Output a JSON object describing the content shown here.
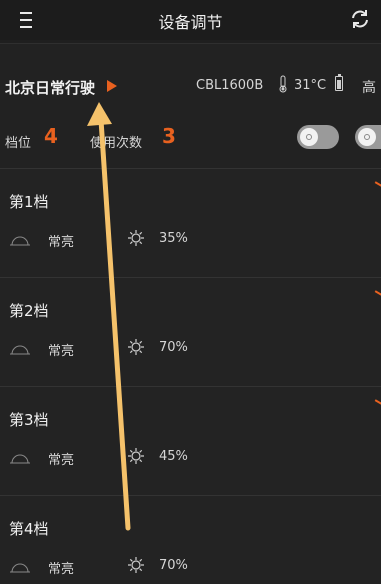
{
  "header": {
    "title": "设备调节"
  },
  "device": {
    "mode_name": "北京日常行驶",
    "model": "CBL1600B",
    "temperature": "31°C",
    "level_tag": "高"
  },
  "stats": {
    "gear_label": "档位",
    "gear_count": "4",
    "use_label": "使用次数",
    "use_count": "3"
  },
  "gears": [
    {
      "name": "第1档",
      "mode": "常亮",
      "brightness": "35%"
    },
    {
      "name": "第2档",
      "mode": "常亮",
      "brightness": "70%"
    },
    {
      "name": "第3档",
      "mode": "常亮",
      "brightness": "45%"
    },
    {
      "name": "第4档",
      "mode": "常亮",
      "brightness": "70%"
    }
  ],
  "colors": {
    "accent": "#e8611f",
    "annotation_arrow": "#f5c26b",
    "background": "#1f1f1f"
  },
  "icons": [
    "menu-icon",
    "refresh-icon",
    "play-arrow-icon",
    "thermometer-icon",
    "battery-icon",
    "steady-light-icon",
    "brightness-icon"
  ]
}
